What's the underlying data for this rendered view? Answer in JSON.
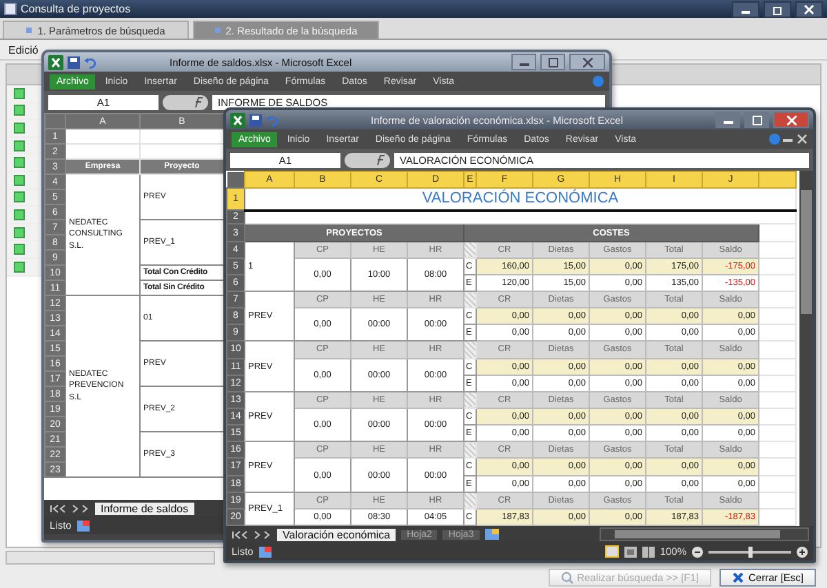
{
  "app": {
    "title": "Consulta de proyectos"
  },
  "tabs": [
    {
      "label": "1. Parámetros de búsqueda",
      "selected": false
    },
    {
      "label": "2. Resultado de la búsqueda",
      "selected": true
    }
  ],
  "menu": [
    "Edició"
  ],
  "back_window": {
    "title": "Informe de saldos.xlsx - Microsoft Excel",
    "ribbon_tabs": [
      {
        "label": "Archivo",
        "selected": true
      },
      {
        "label": "Inicio",
        "selected": false
      },
      {
        "label": "Insertar",
        "selected": false
      },
      {
        "label": "Diseño de página",
        "selected": false
      },
      {
        "label": "Fórmulas",
        "selected": false
      },
      {
        "label": "Datos",
        "selected": false
      },
      {
        "label": "Revisar",
        "selected": false
      },
      {
        "label": "Vista",
        "selected": false
      }
    ],
    "name_box": "A1",
    "formula": "INFORME DE SALDOS",
    "columns": [
      "A",
      "B"
    ],
    "top_rows": [
      "1",
      "2",
      "3"
    ],
    "headers": [
      "Empresa",
      "Proyecto"
    ],
    "companies": [
      {
        "name": "NEDATEC CONSULTING S.L.",
        "projects": [
          {
            "label": "PREV",
            "kind": "project",
            "rows": [
              "4",
              "5",
              "6"
            ]
          },
          {
            "label": "PREV_1",
            "kind": "project",
            "rows": [
              "7",
              "8",
              "9"
            ]
          },
          {
            "label": "Total Con Crédito",
            "kind": "total",
            "rows": [
              "10"
            ]
          },
          {
            "label": "Total Sin Crédito",
            "kind": "total",
            "rows": [
              "11"
            ]
          }
        ]
      },
      {
        "name": "NEDATEC PREVENCION S.L",
        "projects": [
          {
            "label": "01",
            "kind": "project",
            "rows": [
              "12",
              "13",
              "14"
            ]
          },
          {
            "label": "PREV",
            "kind": "project",
            "rows": [
              "15",
              "16",
              "17"
            ]
          },
          {
            "label": "PREV_2",
            "kind": "project",
            "rows": [
              "18",
              "19",
              "20"
            ]
          },
          {
            "label": "PREV_3",
            "kind": "project",
            "rows": [
              "21",
              "22",
              "23"
            ]
          }
        ]
      }
    ],
    "sheet_tabs": [
      "Informe de saldos"
    ],
    "status": "Listo"
  },
  "front_window": {
    "title": "Informe de valoración económica.xlsx - Microsoft Excel",
    "ribbon_tabs": [
      {
        "label": "Archivo",
        "selected": true
      },
      {
        "label": "Inicio",
        "selected": false
      },
      {
        "label": "Insertar",
        "selected": false
      },
      {
        "label": "Diseño de página",
        "selected": false
      },
      {
        "label": "Fórmulas",
        "selected": false
      },
      {
        "label": "Datos",
        "selected": false
      },
      {
        "label": "Revisar",
        "selected": false
      },
      {
        "label": "Vista",
        "selected": false
      }
    ],
    "name_box": "A1",
    "formula": "VALORACIÓN ECONÓMICA",
    "columns": [
      "A",
      "B",
      "C",
      "D",
      "E",
      "F",
      "G",
      "H",
      "I",
      "J"
    ],
    "title_row": {
      "row": "1",
      "text": "VALORACIÓN ECONÓMICA"
    },
    "blank_row": "2",
    "section_row": {
      "row": "3",
      "left": "PROYECTOS",
      "right": "COSTES"
    },
    "blocks": [
      {
        "rows": [
          "4",
          "5",
          "6"
        ],
        "project": "1",
        "project_headers": [
          "CP",
          "HE",
          "HR"
        ],
        "cost_headers": [
          "CR",
          "Dietas",
          "Gastos",
          "Total",
          "Saldo"
        ],
        "values": [
          "0,00",
          "10:00",
          "08:00"
        ],
        "costs": [
          {
            "type": "C",
            "highlighted": true,
            "negative": true,
            "values": [
              "160,00",
              "15,00",
              "0,00",
              "175,00",
              "-175,00"
            ]
          },
          {
            "type": "E",
            "highlighted": false,
            "negative": true,
            "values": [
              "120,00",
              "15,00",
              "0,00",
              "135,00",
              "-135,00"
            ]
          }
        ]
      },
      {
        "rows": [
          "7",
          "8",
          "9"
        ],
        "project": "PREV",
        "project_headers": [
          "CP",
          "HE",
          "HR"
        ],
        "cost_headers": [
          "CR",
          "Dietas",
          "Gastos",
          "Total",
          "Saldo"
        ],
        "values": [
          "0,00",
          "00:00",
          "00:00"
        ],
        "costs": [
          {
            "type": "C",
            "highlighted": true,
            "negative": false,
            "values": [
              "0,00",
              "0,00",
              "0,00",
              "0,00",
              "0,00"
            ]
          },
          {
            "type": "E",
            "highlighted": false,
            "negative": false,
            "values": [
              "0,00",
              "0,00",
              "0,00",
              "0,00",
              "0,00"
            ]
          }
        ]
      },
      {
        "rows": [
          "10",
          "11",
          "12"
        ],
        "project": "PREV",
        "project_headers": [
          "CP",
          "HE",
          "HR"
        ],
        "cost_headers": [
          "CR",
          "Dietas",
          "Gastos",
          "Total",
          "Saldo"
        ],
        "values": [
          "0,00",
          "00:00",
          "00:00"
        ],
        "costs": [
          {
            "type": "C",
            "highlighted": true,
            "negative": false,
            "values": [
              "0,00",
              "0,00",
              "0,00",
              "0,00",
              "0,00"
            ]
          },
          {
            "type": "E",
            "highlighted": false,
            "negative": false,
            "values": [
              "0,00",
              "0,00",
              "0,00",
              "0,00",
              "0,00"
            ]
          }
        ]
      },
      {
        "rows": [
          "13",
          "14",
          "15"
        ],
        "project": "PREV",
        "project_headers": [
          "CP",
          "HE",
          "HR"
        ],
        "cost_headers": [
          "CR",
          "Dietas",
          "Gastos",
          "Total",
          "Saldo"
        ],
        "values": [
          "0,00",
          "00:00",
          "00:00"
        ],
        "costs": [
          {
            "type": "C",
            "highlighted": true,
            "negative": false,
            "values": [
              "0,00",
              "0,00",
              "0,00",
              "0,00",
              "0,00"
            ]
          },
          {
            "type": "E",
            "highlighted": false,
            "negative": false,
            "values": [
              "0,00",
              "0,00",
              "0,00",
              "0,00",
              "0,00"
            ]
          }
        ]
      },
      {
        "rows": [
          "16",
          "17",
          "18"
        ],
        "project": "PREV",
        "project_headers": [
          "CP",
          "HE",
          "HR"
        ],
        "cost_headers": [
          "CR",
          "Dietas",
          "Gastos",
          "Total",
          "Saldo"
        ],
        "values": [
          "0,00",
          "00:00",
          "00:00"
        ],
        "costs": [
          {
            "type": "C",
            "highlighted": true,
            "negative": false,
            "values": [
              "0,00",
              "0,00",
              "0,00",
              "0,00",
              "0,00"
            ]
          },
          {
            "type": "E",
            "highlighted": false,
            "negative": false,
            "values": [
              "0,00",
              "0,00",
              "0,00",
              "0,00",
              "0,00"
            ]
          }
        ]
      },
      {
        "rows": [
          "19",
          "20"
        ],
        "project": "PREV_1",
        "project_headers": [
          "CP",
          "HE",
          "HR"
        ],
        "cost_headers": [
          "CR",
          "Dietas",
          "Gastos",
          "Total",
          "Saldo"
        ],
        "values": [
          "0,00",
          "08:30",
          "04:05"
        ],
        "costs": [
          {
            "type": "C",
            "highlighted": true,
            "negative": true,
            "values": [
              "187,83",
              "0,00",
              "0,00",
              "187,83",
              "-187,83"
            ]
          }
        ]
      }
    ],
    "sheet_tabs": [
      {
        "label": "Valoración económica",
        "selected": true
      },
      {
        "label": "Hoja2",
        "selected": false
      },
      {
        "label": "Hoja3",
        "selected": false
      }
    ],
    "status": "Listo",
    "zoom": {
      "reading": "100%",
      "level": 0.5
    }
  },
  "buttons": [
    {
      "label": "Realizar búsqueda >> [F1]",
      "disabled": true
    },
    {
      "label": "Cerrar [Esc]",
      "disabled": false
    }
  ]
}
